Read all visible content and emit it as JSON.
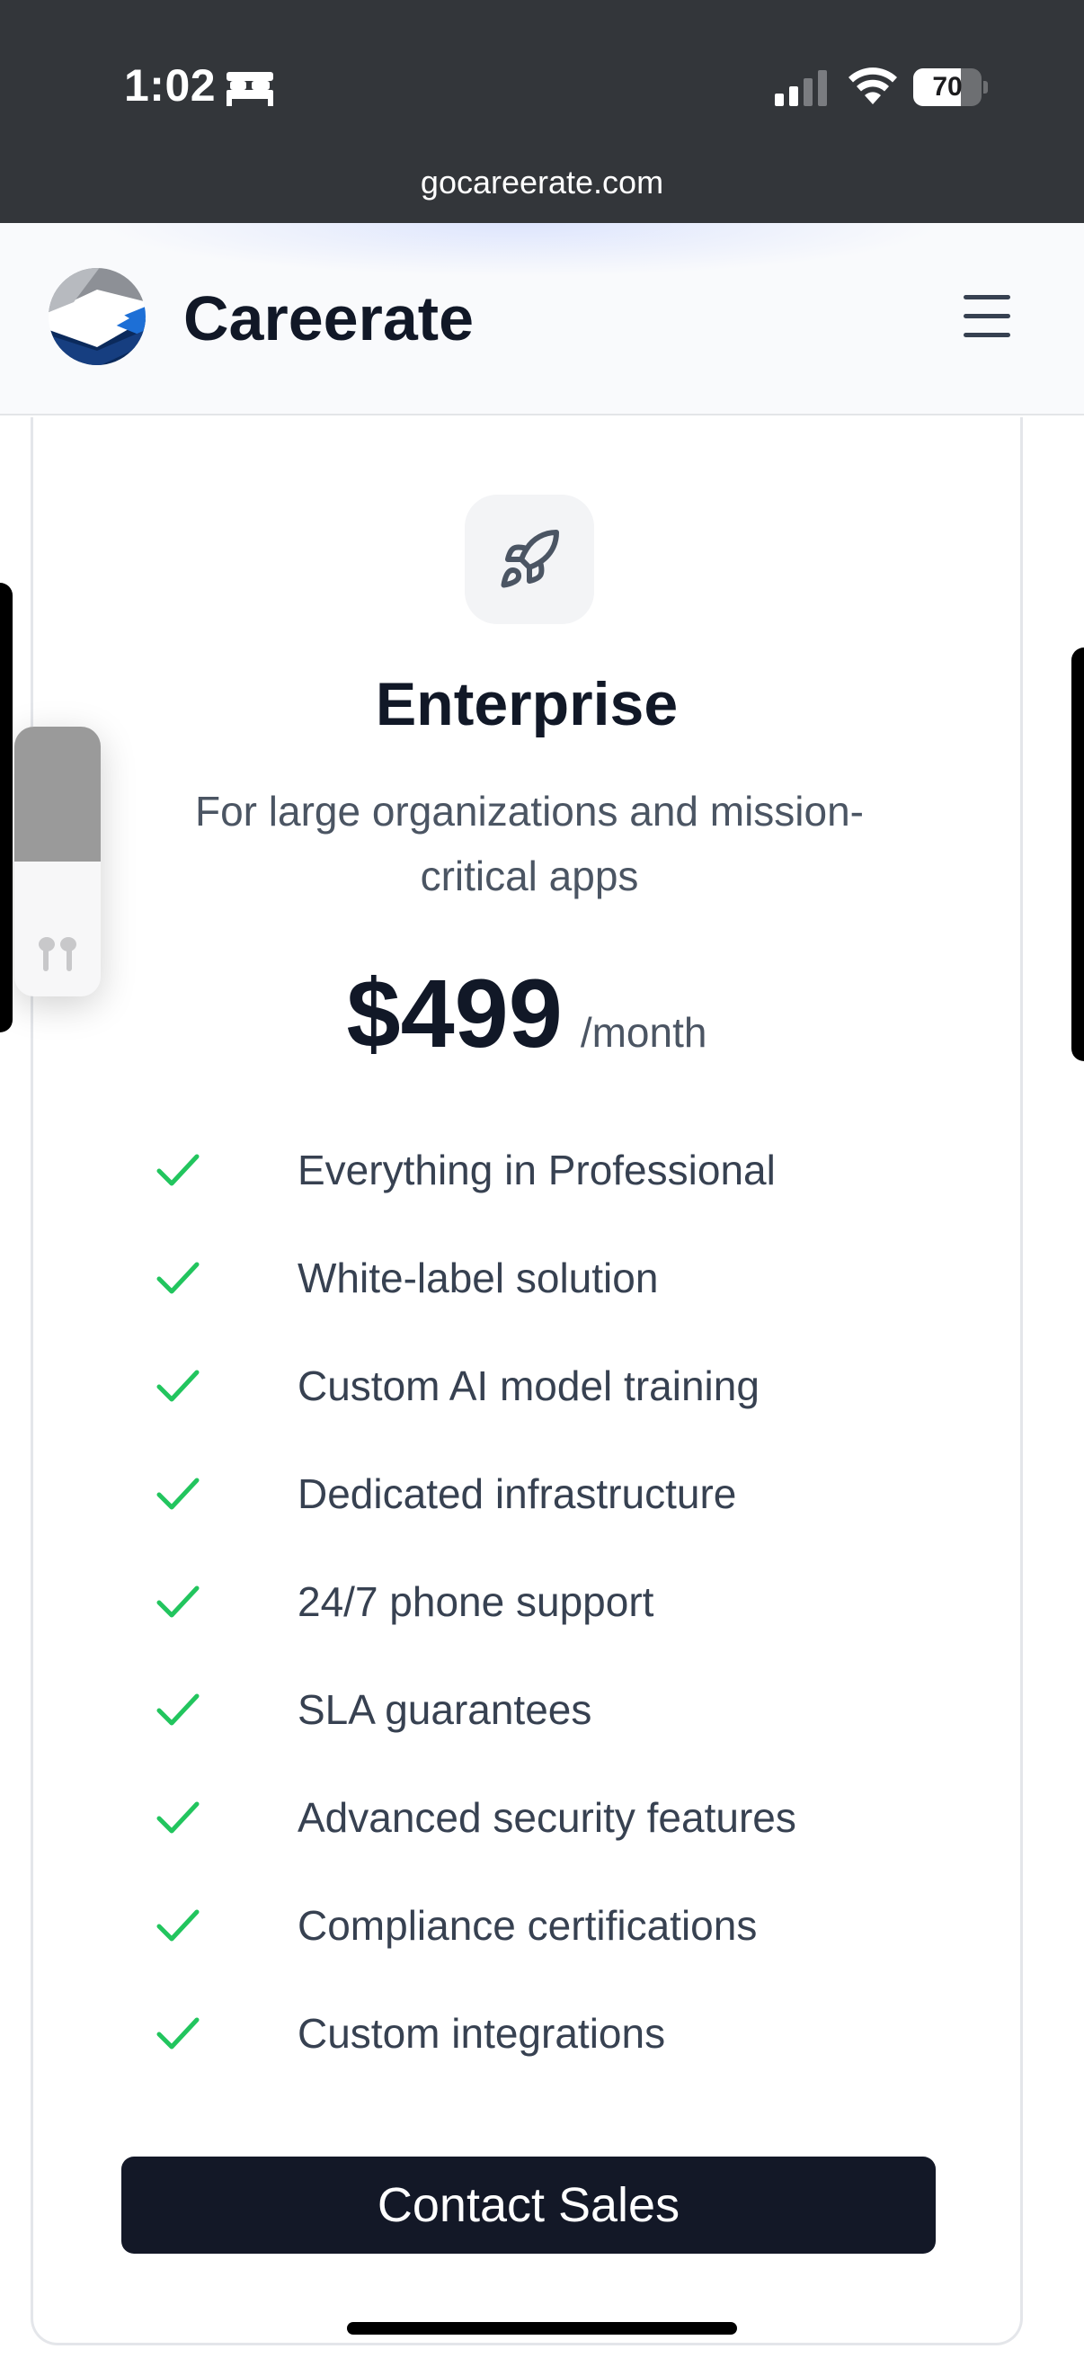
{
  "status_bar": {
    "time": "1:02",
    "battery_percent": "70",
    "battery_level": 0.7,
    "url": "gocareerate.com",
    "icons": [
      "bed-icon",
      "signal-icon",
      "wifi-icon",
      "battery-icon"
    ]
  },
  "header": {
    "brand_name": "Careerate",
    "logo_icon": "careerate-logo",
    "menu_icon": "hamburger-menu-icon"
  },
  "plan": {
    "icon": "rocket-icon",
    "name": "Enterprise",
    "description": "For large organizations and mission-critical apps",
    "price": "$499",
    "period": "/month",
    "features": [
      "Everything in Professional",
      "White-label solution",
      "Custom AI model training",
      "Dedicated infrastructure",
      "24/7 phone support",
      "SLA guarantees",
      "Advanced security features",
      "Compliance certifications",
      "Custom integrations"
    ],
    "cta_label": "Contact Sales"
  },
  "audio_widget": {
    "volume_level": 0.5,
    "icon": "earbuds-icon"
  },
  "colors": {
    "status_bar_bg": "#33363a",
    "text_primary": "#111827",
    "text_secondary": "#4b5563",
    "check_green": "#22c55e",
    "cta_bg": "#131827"
  }
}
